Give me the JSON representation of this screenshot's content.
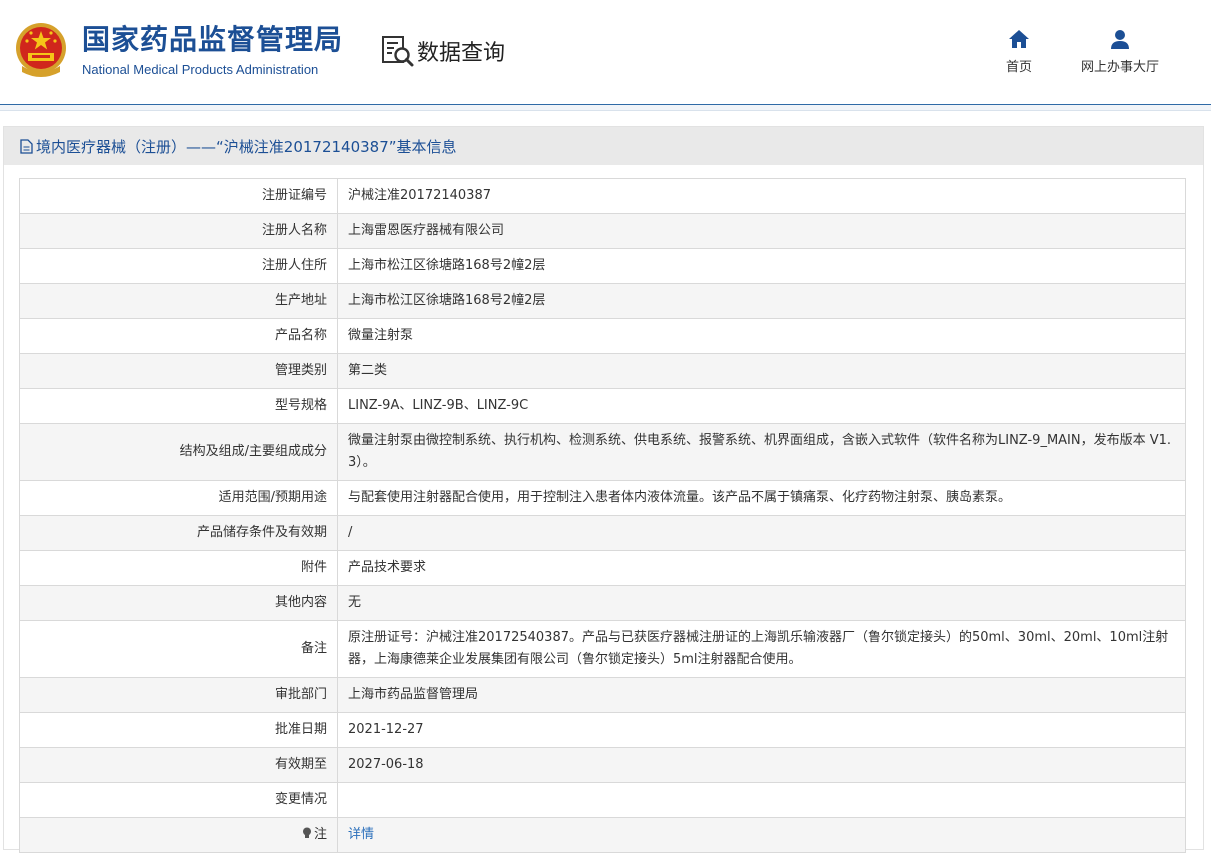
{
  "header": {
    "brand_cn": "国家药品监督管理局",
    "brand_en": "National Medical Products Administration",
    "query_title": "数据查询",
    "nav": [
      {
        "label": "首页",
        "icon": "home-icon"
      },
      {
        "label": "网上办事大厅",
        "icon": "user-icon"
      }
    ]
  },
  "panel": {
    "title": "境内医疗器械（注册）——“沪械注准20172140387”基本信息"
  },
  "rows": [
    {
      "label": "注册证编号",
      "value": "沪械注准20172140387"
    },
    {
      "label": "注册人名称",
      "value": "上海雷恩医疗器械有限公司"
    },
    {
      "label": "注册人住所",
      "value": "上海市松江区徐塘路168号2幢2层"
    },
    {
      "label": "生产地址",
      "value": "上海市松江区徐塘路168号2幢2层"
    },
    {
      "label": "产品名称",
      "value": "微量注射泵"
    },
    {
      "label": "管理类别",
      "value": "第二类"
    },
    {
      "label": "型号规格",
      "value": "LINZ-9A、LINZ-9B、LINZ-9C"
    },
    {
      "label": "结构及组成/主要组成成分",
      "value": "微量注射泵由微控制系统、执行机构、检测系统、供电系统、报警系统、机界面组成，含嵌入式软件（软件名称为LINZ-9_MAIN，发布版本 V1.3）。"
    },
    {
      "label": "适用范围/预期用途",
      "value": "与配套使用注射器配合使用，用于控制注入患者体内液体流量。该产品不属于镇痛泵、化疗药物注射泵、胰岛素泵。"
    },
    {
      "label": "产品储存条件及有效期",
      "value": "/"
    },
    {
      "label": "附件",
      "value": "产品技术要求"
    },
    {
      "label": "其他内容",
      "value": "无"
    },
    {
      "label": "备注",
      "value": "原注册证号：沪械注准20172540387。产品与已获医疗器械注册证的上海凯乐输液器厂（鲁尔锁定接头）的50ml、30ml、20ml、10ml注射器，上海康德莱企业发展集团有限公司（鲁尔锁定接头）5ml注射器配合使用。"
    },
    {
      "label": "审批部门",
      "value": "上海市药品监督管理局"
    },
    {
      "label": "批准日期",
      "value": "2021-12-27"
    },
    {
      "label": "有效期至",
      "value": "2027-06-18"
    },
    {
      "label": "变更情况",
      "value": ""
    }
  ],
  "note_row": {
    "label": "注",
    "link": "详情"
  }
}
